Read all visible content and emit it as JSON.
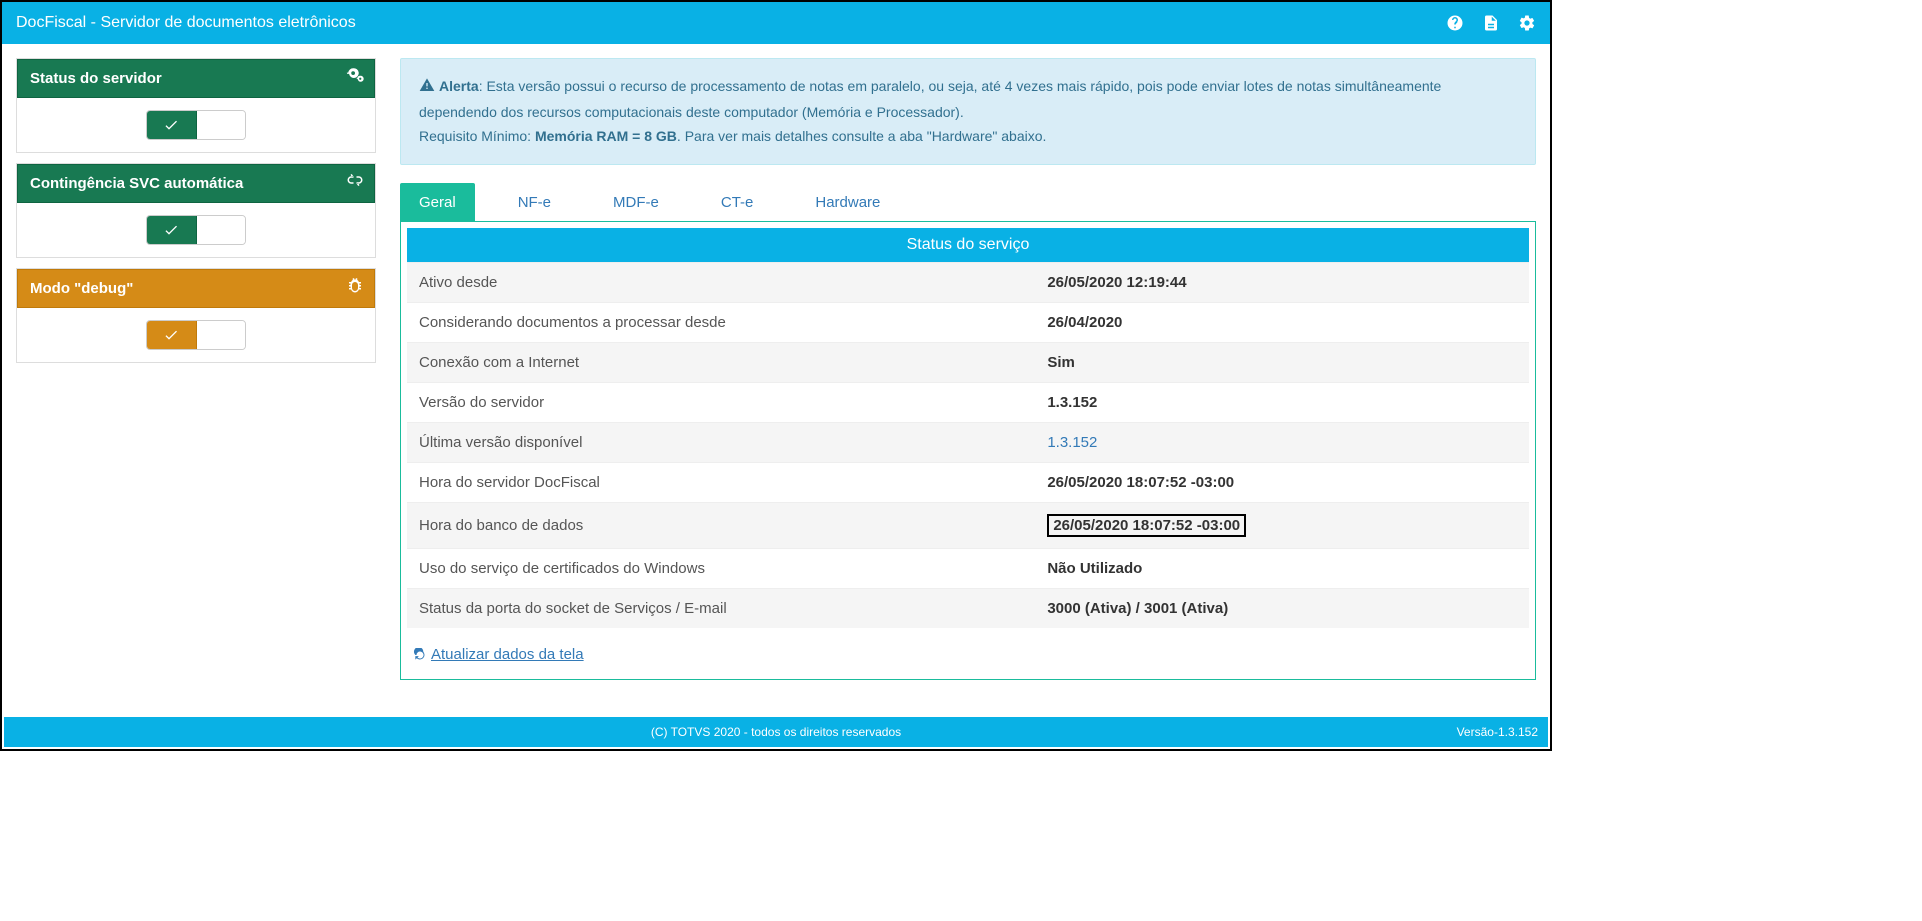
{
  "app": {
    "title": "DocFiscal - Servidor de documentos eletrônicos"
  },
  "sidebar": {
    "cards": [
      {
        "title": "Status do servidor",
        "theme": "green",
        "icon": "cogs"
      },
      {
        "title": "Contingência SVC automática",
        "theme": "green",
        "icon": "broken-link"
      },
      {
        "title": "Modo \"debug\"",
        "theme": "orange",
        "icon": "bug"
      }
    ]
  },
  "alert": {
    "label": "Alerta",
    "text1": ": Esta versão possui o recurso de processamento de notas em paralelo, ou seja, até 4 vezes mais rápido, pois pode enviar lotes de notas simultâneamente dependendo dos recursos computacionais deste computador (Memória e Processador).",
    "text2a": "Requisito Mínimo: ",
    "text2b": "Memória RAM = 8 GB",
    "text2c": ". Para ver mais detalhes consulte a aba \"Hardware\" abaixo."
  },
  "tabs": [
    "Geral",
    "NF-e",
    "MDF-e",
    "CT-e",
    "Hardware"
  ],
  "active_tab": 0,
  "panel": {
    "title": "Status do serviço",
    "rows": [
      {
        "label": "Ativo desde",
        "value": "26/05/2020 12:19:44"
      },
      {
        "label": "Considerando documentos a processar desde",
        "value": "26/04/2020"
      },
      {
        "label": "Conexão com a Internet",
        "value": "Sim"
      },
      {
        "label": "Versão do servidor",
        "value": "1.3.152"
      },
      {
        "label": "Última versão disponível",
        "value": "1.3.152",
        "link": true
      },
      {
        "label": "Hora do servidor DocFiscal",
        "value": "26/05/2020 18:07:52 -03:00"
      },
      {
        "label": "Hora do banco de dados",
        "value": "26/05/2020 18:07:52 -03:00",
        "boxed": true
      },
      {
        "label": "Uso do serviço de certificados do Windows",
        "value": "Não Utilizado"
      },
      {
        "label": "Status da porta do socket de Serviços / E-mail",
        "value": "3000 (Ativa) / 3001 (Ativa)"
      }
    ],
    "refresh_label": "Atualizar dados da tela"
  },
  "footer": {
    "copyright": "(C) TOTVS 2020 - todos os direitos reservados",
    "version": "Versão-1.3.152"
  }
}
